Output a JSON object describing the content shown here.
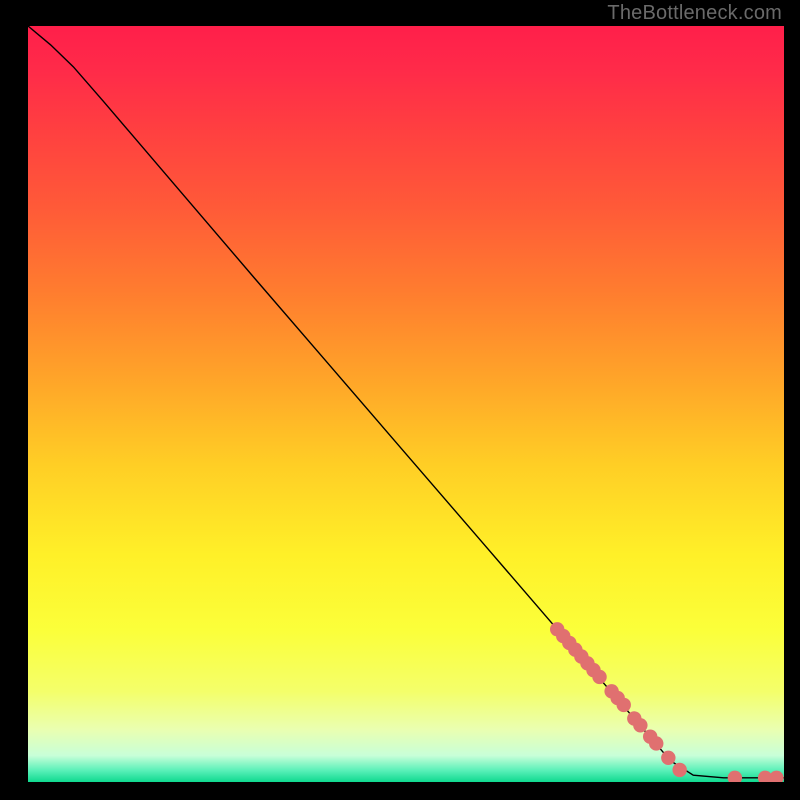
{
  "watermark": "TheBottleneck.com",
  "chart_data": {
    "type": "line",
    "title": "",
    "xlabel": "",
    "ylabel": "",
    "xlim": [
      0,
      100
    ],
    "ylim": [
      0,
      100
    ],
    "curve": [
      {
        "x": 0,
        "y": 100
      },
      {
        "x": 3,
        "y": 97.5
      },
      {
        "x": 6,
        "y": 94.6
      },
      {
        "x": 10,
        "y": 90.0
      },
      {
        "x": 20,
        "y": 78.3
      },
      {
        "x": 30,
        "y": 66.6
      },
      {
        "x": 40,
        "y": 55.0
      },
      {
        "x": 50,
        "y": 43.4
      },
      {
        "x": 60,
        "y": 31.8
      },
      {
        "x": 70,
        "y": 20.2
      },
      {
        "x": 80,
        "y": 8.6
      },
      {
        "x": 85,
        "y": 2.8
      },
      {
        "x": 88,
        "y": 0.9
      },
      {
        "x": 92,
        "y": 0.55
      },
      {
        "x": 100,
        "y": 0.55
      }
    ],
    "markers": [
      {
        "x": 70.0,
        "y": 20.2
      },
      {
        "x": 70.8,
        "y": 19.3
      },
      {
        "x": 71.6,
        "y": 18.4
      },
      {
        "x": 72.4,
        "y": 17.5
      },
      {
        "x": 73.2,
        "y": 16.6
      },
      {
        "x": 74.0,
        "y": 15.7
      },
      {
        "x": 74.8,
        "y": 14.8
      },
      {
        "x": 75.6,
        "y": 13.9
      },
      {
        "x": 77.2,
        "y": 12.0
      },
      {
        "x": 78.0,
        "y": 11.1
      },
      {
        "x": 78.8,
        "y": 10.2
      },
      {
        "x": 80.2,
        "y": 8.4
      },
      {
        "x": 81.0,
        "y": 7.5
      },
      {
        "x": 82.3,
        "y": 6.0
      },
      {
        "x": 83.1,
        "y": 5.1
      },
      {
        "x": 84.7,
        "y": 3.2
      },
      {
        "x": 86.2,
        "y": 1.6
      },
      {
        "x": 93.5,
        "y": 0.55
      },
      {
        "x": 97.5,
        "y": 0.55
      },
      {
        "x": 99.0,
        "y": 0.55
      }
    ],
    "gradient_stops": [
      {
        "offset": 0.0,
        "color": "#ff1f4a"
      },
      {
        "offset": 0.06,
        "color": "#ff2b49"
      },
      {
        "offset": 0.14,
        "color": "#ff4040"
      },
      {
        "offset": 0.24,
        "color": "#ff5a38"
      },
      {
        "offset": 0.35,
        "color": "#ff7c2f"
      },
      {
        "offset": 0.46,
        "color": "#ffa229"
      },
      {
        "offset": 0.58,
        "color": "#ffce25"
      },
      {
        "offset": 0.7,
        "color": "#fff028"
      },
      {
        "offset": 0.8,
        "color": "#fbff3a"
      },
      {
        "offset": 0.88,
        "color": "#f4ff6a"
      },
      {
        "offset": 0.93,
        "color": "#eaffb0"
      },
      {
        "offset": 0.965,
        "color": "#c8ffd8"
      },
      {
        "offset": 0.985,
        "color": "#58f0b8"
      },
      {
        "offset": 1.0,
        "color": "#0fd98f"
      }
    ],
    "marker_color": "#e07070",
    "curve_color": "#000000"
  }
}
